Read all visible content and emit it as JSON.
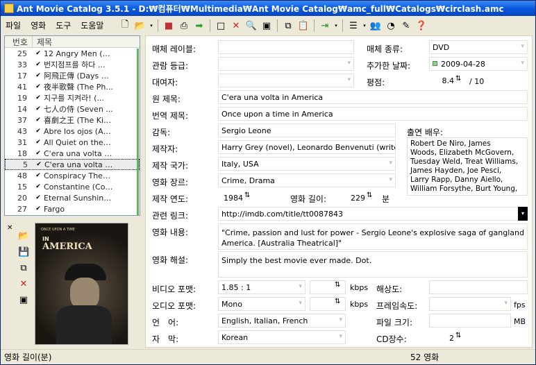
{
  "title": "Ant Movie Catalog 3.5.1 - D:₩컴퓨터₩Multimedia₩Ant Movie Catalog₩amc_full₩Catalogs₩circlash.amc",
  "menu": [
    "파일",
    "영화",
    "도구",
    "도움말"
  ],
  "list": {
    "col_num": "번호",
    "col_title": "제목",
    "rows": [
      {
        "n": "25",
        "t": "12 Angry Men (Tw..."
      },
      {
        "n": "33",
        "t": "번지점프를 하다 ..."
      },
      {
        "n": "17",
        "t": "阿飛正傳 (Days of..."
      },
      {
        "n": "41",
        "t": "夜半歌聲 (The Ph..."
      },
      {
        "n": "19",
        "t": "지구를 지켜라! (..."
      },
      {
        "n": "14",
        "t": "七人の侍 (Seven ..."
      },
      {
        "n": "37",
        "t": "喜劇之王 (The Kin..."
      },
      {
        "n": "43",
        "t": "Abre los ojos (Apri ..."
      },
      {
        "n": "31",
        "t": "All Quiet on the W..."
      },
      {
        "n": "18",
        "t": "C'era una volta il ..."
      },
      {
        "n": "5",
        "t": "C'era una volta in ..."
      },
      {
        "n": "48",
        "t": "Conspiracy Theory"
      },
      {
        "n": "15",
        "t": "Constantine (Cons..."
      },
      {
        "n": "20",
        "t": "Eternal Sunshine o..."
      },
      {
        "n": "27",
        "t": "Fargo"
      }
    ]
  },
  "poster": {
    "line1": "ONCE UPON A TIME",
    "line2": "IN",
    "line3": "AMERICA"
  },
  "labels": {
    "media_label": "매체 레이블:",
    "media_type": "매체 종류:",
    "rating_grade": "관람 등급:",
    "date_added": "추가한 날짜:",
    "borrower": "대여자:",
    "score": "평점:",
    "orig_title": "원 제목:",
    "trans_title": "번역 제목:",
    "director": "감독:",
    "actors": "출연 배우:",
    "producer": "제작자:",
    "country": "제작 국가:",
    "genre": "영화 장르:",
    "year": "제작 연도:",
    "length": "영화 길이:",
    "min": "분",
    "url": "관련 링크:",
    "description": "영화 내용:",
    "comments": "영화 해설:",
    "video": "비디오 포맷:",
    "kbps1": "kbps",
    "resolution": "해상도:",
    "audio": "오디오 포맷:",
    "kbps2": "kbps",
    "framerate": "프레임속도:",
    "fps": "fps",
    "languages": "언　어:",
    "filesize": "파일 크기:",
    "mb": "MB",
    "subtitles": "자　막:",
    "disks": "CD장수:"
  },
  "values": {
    "media_type": "DVD",
    "date_added": "2009-04-28",
    "score": "8.4",
    "score_max": "/ 10",
    "orig_title": "C'era una volta in America",
    "trans_title": "Once upon a time in America",
    "director": "Sergio Leone",
    "producer": "Harry Grey (novel), Leonardo Benvenuti (writer)",
    "country": "Italy, USA",
    "genre": "Crime, Drama",
    "year": "1984",
    "length": "229",
    "url": "http://imdb.com/title/tt0087843",
    "actors": "Robert De Niro, James Woods, Elizabeth McGovern, Tuesday Weld, Treat Williams, James Hayden, Joe Pesci, Larry Rapp, Danny Aiello, William Forsythe, Burt Young,",
    "description": "\"Crime, passion and lust for power - Sergio Leone's explosive saga of gangland America. [Australia Theatrical]\"",
    "comments": "Simply the best movie ever made. Dot.",
    "video": "1.85 : 1",
    "audio": "Mono",
    "languages": "English, Italian, French",
    "subtitles": "Korean",
    "disks": "2"
  },
  "status": {
    "left": "영화 길이(분)",
    "count": "52 영화"
  }
}
